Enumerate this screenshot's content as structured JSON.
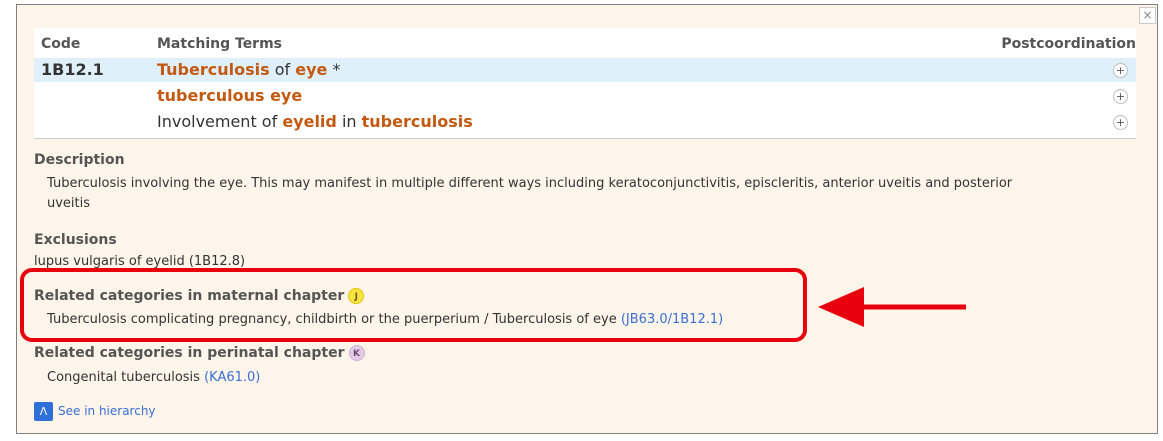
{
  "close_glyph": "×",
  "table": {
    "headers": {
      "code": "Code",
      "terms": "Matching Terms",
      "postcoordination": "Postcoordination"
    },
    "plus_glyph": "+",
    "rows": [
      {
        "code": "1B12.1",
        "parts": [
          "Tuberculosis",
          " of ",
          "eye",
          " *"
        ]
      },
      {
        "code": "",
        "parts": [
          "tuberculous eye"
        ]
      },
      {
        "code": "",
        "parts": [
          "Involvement of ",
          "eyelid",
          " in ",
          "tuberculosis"
        ]
      }
    ]
  },
  "description": {
    "title": "Description",
    "line1": "Tuberculosis involving the eye. This may manifest in multiple different ways including keratoconjunctivitis, episcleritis, anterior uveitis and posterior",
    "line2": "uveitis"
  },
  "exclusions": {
    "title": "Exclusions",
    "item": "lupus vulgaris of eyelid (1B12.8)"
  },
  "maternal": {
    "title": "Related categories in maternal chapter",
    "badge": "J",
    "text": "Tuberculosis complicating pregnancy, childbirth or the puerperium / Tuberculosis of eye",
    "link": "(JB63.0/1B12.1)"
  },
  "perinatal": {
    "title": "Related categories in perinatal chapter",
    "badge": "K",
    "text": "Congenital tuberculosis",
    "link": "(KA61.0)"
  },
  "hierarchy": {
    "icon": "Λ",
    "label": "See in hierarchy"
  },
  "colors": {
    "panel_bg": "#fdf4ea",
    "keyword": "#c45a11",
    "highlight_row": "#dff0fb",
    "link": "#3b6fd4",
    "annotation": "#e8000e"
  },
  "icons": [
    "close-icon",
    "add-postcoordination-icon",
    "hierarchy-icon",
    "annotation-arrow"
  ]
}
